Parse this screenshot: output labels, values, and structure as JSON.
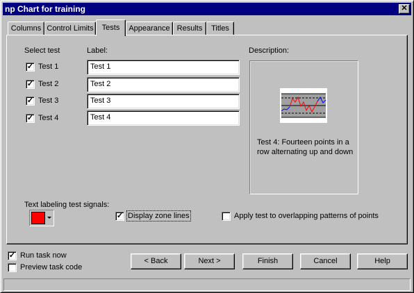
{
  "window": {
    "title": "np Chart for training",
    "close_glyph": "✕"
  },
  "tabs": [
    "Columns",
    "Control Limits",
    "Tests",
    "Appearance",
    "Results",
    "Titles"
  ],
  "active_tab": "Tests",
  "select_test_header": "Select test",
  "label_header": "Label:",
  "tests": [
    {
      "name": "Test 1",
      "checked": true,
      "label": "Test 1"
    },
    {
      "name": "Test 2",
      "checked": true,
      "label": "Test 2"
    },
    {
      "name": "Test 3",
      "checked": true,
      "label": "Test 3"
    },
    {
      "name": "Test 4",
      "checked": true,
      "label": "Test 4"
    }
  ],
  "description": {
    "header": "Description:",
    "text": "Test 4: Fourteen points in a row alternating up and down"
  },
  "text_labeling": {
    "label": "Text labeling test signals:",
    "color": "#ff0000"
  },
  "display_zone_lines": {
    "label": "Display zone lines",
    "checked": true
  },
  "apply_overlap": {
    "label": "Apply test to overlapping patterns of points",
    "checked": false
  },
  "run_task_now": {
    "label": "Run task now",
    "checked": true
  },
  "preview_task_code": {
    "label": "Preview task code",
    "checked": false
  },
  "buttons": {
    "back": "< Back",
    "next": "Next >",
    "finish": "Finish",
    "cancel": "Cancel",
    "help": "Help"
  },
  "colors": {
    "titlebar": "#000080",
    "face": "#c0c0c0",
    "signal_red": "#ff0000",
    "series_blue": "#0000ff"
  }
}
